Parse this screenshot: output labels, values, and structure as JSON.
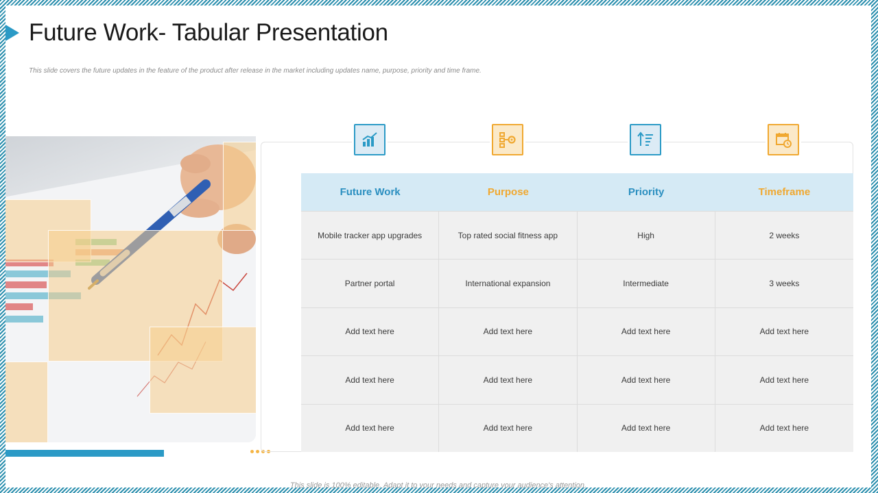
{
  "title": "Future Work- Tabular Presentation",
  "subtitle": "This slide covers the future updates in the feature of the product after release in the market including updates name, purpose, priority and time frame.",
  "table": {
    "headers": [
      {
        "label": "Future Work",
        "color": "#2b8fc0",
        "icon": "bar-chart-icon"
      },
      {
        "label": "Purpose",
        "color": "#f0a830",
        "icon": "flowchart-gear-icon"
      },
      {
        "label": "Priority",
        "color": "#2b8fc0",
        "icon": "sort-ascending-icon"
      },
      {
        "label": "Timeframe",
        "color": "#f0a830",
        "icon": "calendar-clock-icon"
      }
    ],
    "rows": [
      [
        "Mobile tracker app upgrades",
        "Top rated social fitness app",
        "High",
        "2 weeks"
      ],
      [
        "Partner portal",
        "International expansion",
        "Intermediate",
        "3 weeks"
      ],
      [
        "Add text here",
        "Add text here",
        "Add text here",
        "Add text here"
      ],
      [
        "Add text here",
        "Add text here",
        "Add text here",
        "Add text here"
      ],
      [
        "Add text here",
        "Add text here",
        "Add text here",
        "Add text here"
      ]
    ]
  },
  "footer": "This slide is 100% editable. Adapt it to your needs and capture your audience's attention.",
  "colors": {
    "accent_blue": "#2b9ac6",
    "accent_orange": "#f0a830",
    "header_bg": "#d5eaf5"
  }
}
